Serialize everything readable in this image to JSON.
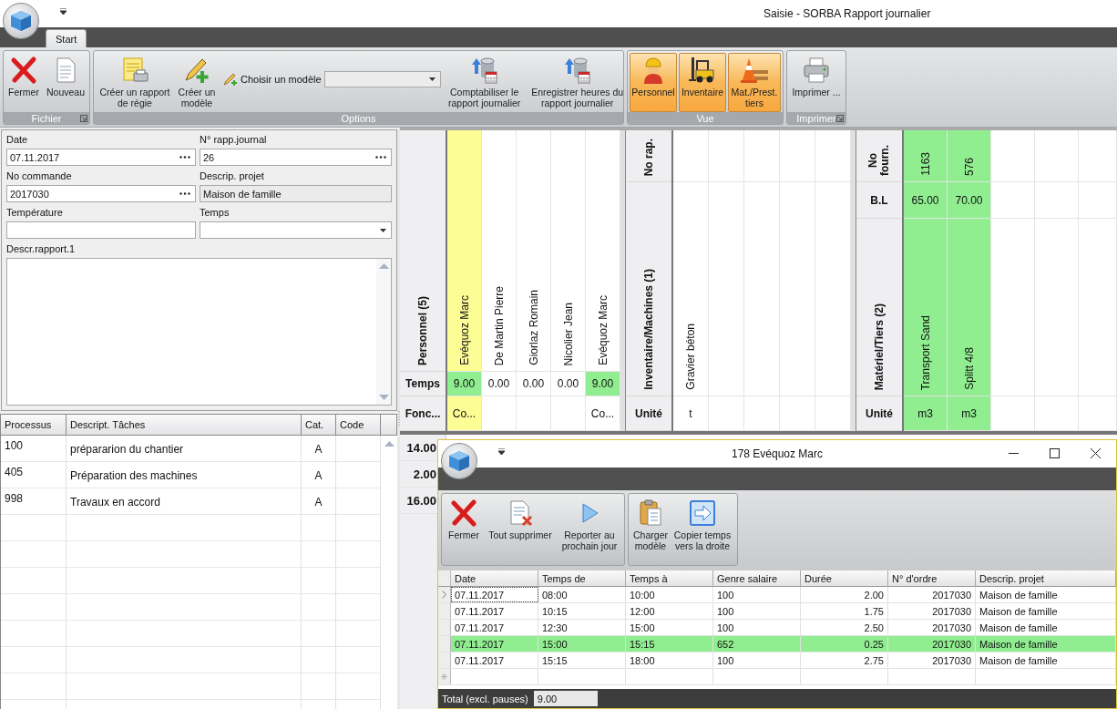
{
  "window": {
    "title": "Saisie - SORBA Rapport journalier"
  },
  "tabs": [
    {
      "label": "Start",
      "selected": true
    }
  ],
  "ribbon": {
    "groups": [
      {
        "label": "Fichier",
        "launcher": true,
        "items": [
          {
            "kind": "large",
            "label": "Fermer"
          },
          {
            "kind": "large",
            "label": "Nouveau"
          }
        ]
      },
      {
        "label": "Options",
        "launcher": false,
        "items": [
          {
            "kind": "large",
            "label": "Créer un rapport\nde régie"
          },
          {
            "kind": "large",
            "label": "Créer un\nmodèle"
          },
          {
            "kind": "combo",
            "label": "Choisir un modèle"
          },
          {
            "kind": "large",
            "label": "Comptabiliser le\nrapport journalier"
          },
          {
            "kind": "large",
            "label": "Enregistrer heures du\nrapport journalier"
          }
        ]
      },
      {
        "label": "Vue",
        "launcher": false,
        "items": [
          {
            "kind": "toggle",
            "label": "Personnel",
            "selected": true
          },
          {
            "kind": "toggle",
            "label": "Inventaire",
            "selected": true
          },
          {
            "kind": "toggle",
            "label": "Mat./Prest.\ntiers",
            "selected": true
          }
        ]
      },
      {
        "label": "Imprimer",
        "launcher": true,
        "items": [
          {
            "kind": "large",
            "label": "Imprimer ..."
          }
        ]
      }
    ]
  },
  "form": {
    "fields": [
      {
        "label": "Date",
        "value": "07.11.2017",
        "kind": "lookup"
      },
      {
        "label": "N° rapp.journal",
        "value": "26",
        "kind": "lookup"
      },
      {
        "label": "No commande",
        "value": "2017030",
        "kind": "lookup"
      },
      {
        "label": "Descrip. projet",
        "value": "Maison de famille",
        "kind": "readonly"
      },
      {
        "label": "Température",
        "kind": "text"
      },
      {
        "label": "Temps",
        "kind": "dropdown"
      }
    ],
    "memo": {
      "label": "Descr.rapport.1"
    }
  },
  "tasks": {
    "columns": [
      "Processus",
      "Descript.  Tâches",
      "Cat.",
      "Code"
    ],
    "rows": [
      {
        "processus": "100",
        "description": "prépararion du chantier",
        "cat": "A"
      },
      {
        "processus": "405",
        "description": "Préparation des machines",
        "cat": "A"
      },
      {
        "processus": "998",
        "description": "Travaux en accord",
        "cat": "A"
      }
    ]
  },
  "grid": {
    "personnel": {
      "title": "Personnel (5)",
      "time_label": "Temps",
      "function_label": "Fonc...",
      "columns": [
        {
          "name": "Evéquoz Marc",
          "time": "9.00",
          "function": "Co...",
          "selected": true,
          "time_marked": true
        },
        {
          "name": "De Martin Pierre",
          "time": "0.00",
          "selected": false,
          "time_marked": false
        },
        {
          "name": "Giorlaz Romain",
          "time": "0.00",
          "selected": false,
          "time_marked": false
        },
        {
          "name": "Nicolier Jean",
          "time": "0.00",
          "selected": false,
          "time_marked": false
        },
        {
          "name": "Evéquoz Marc",
          "time": "9.00",
          "function": "Co...",
          "selected": false,
          "time_marked": true
        }
      ]
    },
    "inventory": {
      "title": "Inventaire/Machines (1)",
      "number_label": "No rap.",
      "unit_label": "Unité",
      "columns": [
        {
          "name": "Gravier béton",
          "unit": "t"
        }
      ]
    },
    "material": {
      "title": "Matériel/Tiers (2)",
      "number_label": "No\nfourn.",
      "bl_label": "B.L",
      "unit_label": "Unité",
      "columns": [
        {
          "number": "1163",
          "bl": "65.00",
          "name": "Transport Sand",
          "unit": "m3",
          "marked": true
        },
        {
          "number": "576",
          "bl": "70.00",
          "name": "Splitt 4/8",
          "unit": "m3",
          "marked": true
        }
      ]
    },
    "totals": [
      "14.00",
      "2.00",
      "16.00"
    ]
  },
  "dialog": {
    "title": "178 Evéquoz Marc",
    "groups": [
      [
        "Fermer",
        "Tout supprimer",
        "Reporter au\nprochain jour"
      ],
      [
        "Charger\nmodèle",
        "Copier temps\nvers la droite"
      ]
    ],
    "table": {
      "columns": [
        "Date",
        "Temps de",
        "Temps à",
        "Genre salaire",
        "Durée",
        "N° d'ordre",
        "Descrip. projet"
      ],
      "rows": [
        {
          "cells": [
            "07.11.2017",
            "08:00",
            "10:00",
            "100",
            "2.00",
            "2017030",
            "Maison de famille"
          ],
          "current": true,
          "marked": false
        },
        {
          "cells": [
            "07.11.2017",
            "10:15",
            "12:00",
            "100",
            "1.75",
            "2017030",
            "Maison de famille"
          ],
          "current": false,
          "marked": false
        },
        {
          "cells": [
            "07.11.2017",
            "12:30",
            "15:00",
            "100",
            "2.50",
            "2017030",
            "Maison de famille"
          ],
          "current": false,
          "marked": false
        },
        {
          "cells": [
            "07.11.2017",
            "15:00",
            "15:15",
            "652",
            "0.25",
            "2017030",
            "Maison de famille"
          ],
          "current": false,
          "marked": true
        },
        {
          "cells": [
            "07.11.2017",
            "15:15",
            "18:00",
            "100",
            "2.75",
            "2017030",
            "Maison de famille"
          ],
          "current": false,
          "marked": false
        }
      ]
    },
    "total": {
      "label": "Total (excl. pauses)",
      "value": "9.00"
    }
  }
}
